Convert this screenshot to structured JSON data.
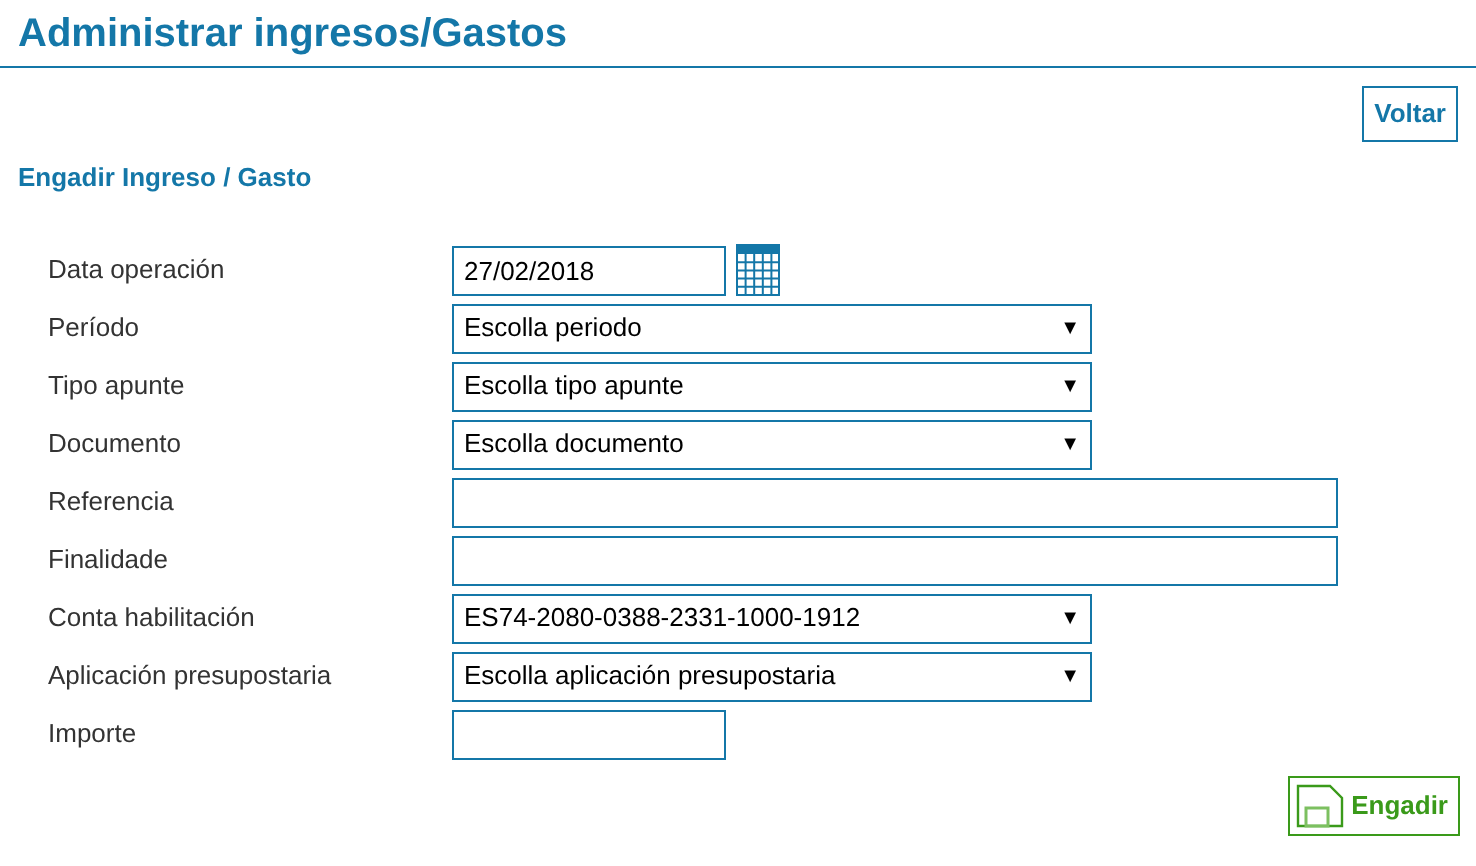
{
  "page_title": "Administrar ingresos/Gastos",
  "back_button": "Voltar",
  "section_title": "Engadir Ingreso / Gasto",
  "fields": [
    {
      "label": "Data operación",
      "kind": "date",
      "value": "27/02/2018"
    },
    {
      "label": "Período",
      "kind": "select",
      "value": "Escolla periodo",
      "caret": "▼"
    },
    {
      "label": "Tipo apunte",
      "kind": "select",
      "value": "Escolla tipo apunte",
      "caret": "▼"
    },
    {
      "label": "Documento",
      "kind": "select",
      "value": "Escolla documento",
      "caret": "▼"
    },
    {
      "label": "Referencia",
      "kind": "text"
    },
    {
      "label": "Finalidade",
      "kind": "text"
    },
    {
      "label": "Conta habilitación",
      "kind": "select",
      "value": "ES74-2080-0388-2331-1000-1912",
      "caret": "▼"
    },
    {
      "label": "Aplicación presupostaria",
      "kind": "select",
      "value": "Escolla aplicación presupostaria",
      "caret": "▼"
    },
    {
      "label": "Importe",
      "kind": "short"
    }
  ],
  "submit_button": "Engadir"
}
